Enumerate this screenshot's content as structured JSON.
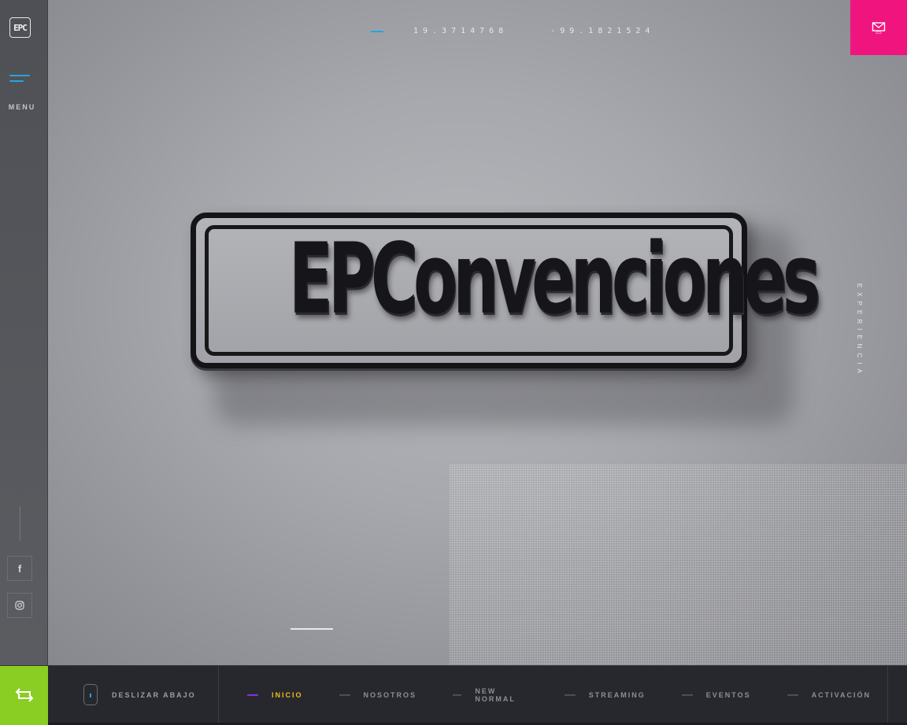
{
  "brand": {
    "logo_text": "EPC",
    "sign_text": "EPConvenciones"
  },
  "sidebar": {
    "menu_label": "MENU"
  },
  "header": {
    "latitude": "19.3714768",
    "longitude": "-99.1821524"
  },
  "side_label": "EXPERIENCIA",
  "footer": {
    "scroll_label": "DESLIZAR ABAJO",
    "nav": [
      {
        "label": "INICIO",
        "active": true
      },
      {
        "label": "NOSOTROS",
        "active": false
      },
      {
        "label": "NEW NORMAL",
        "active": false
      },
      {
        "label": "STREAMING",
        "active": false
      },
      {
        "label": "EVENTOS",
        "active": false
      },
      {
        "label": "ACTIVACIÓN",
        "active": false
      }
    ]
  },
  "icons": {
    "facebook": "facebook-icon",
    "instagram": "instagram-icon",
    "mail": "mail-icon",
    "toggle": "repeat-icon"
  },
  "colors": {
    "accent_blue": "#27a4d9",
    "mail_pink": "#f0157e",
    "green": "#8acd23",
    "active_yellow": "#f2b91d",
    "active_purple": "#8b2fd8"
  }
}
